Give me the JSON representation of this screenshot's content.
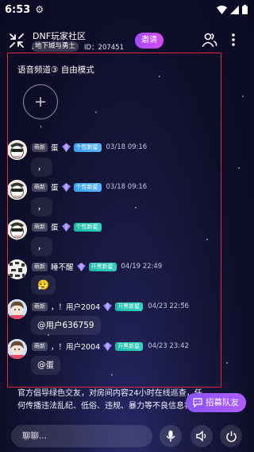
{
  "status_bar": {
    "time": "6:53"
  },
  "header": {
    "room_title": "DNF玩家社区",
    "room_tag": "地下城与勇士",
    "room_id": "ID：207451",
    "invite_label": "邀请"
  },
  "mic_area": {
    "channel_label": "语音频道③ 自由模式"
  },
  "messages": [
    {
      "badge": "萌新",
      "username": "蛋",
      "pill": "个性新星",
      "time": "03/18 09:16",
      "text": "，"
    },
    {
      "badge": "萌新",
      "username": "蛋",
      "pill": "个性新星",
      "time": "03/18 09:16",
      "text": "，"
    },
    {
      "badge": "萌新",
      "username": "蛋",
      "pill": "个性新星",
      "time": "",
      "text": "，"
    },
    {
      "badge": "萌新",
      "username": "睡不醒",
      "pill": "开黑新星",
      "time": "04/19 22:49",
      "text": "😮‍💨"
    },
    {
      "badge": "萌新",
      "username": "，！用户2004",
      "pill": "开黑新星",
      "time": "04/23 22:56",
      "text": "@用户636759"
    },
    {
      "badge": "萌新",
      "username": "，！用户2004",
      "pill": "开黑新星",
      "time": "04/23 23:42",
      "text": "@蛋"
    }
  ],
  "notice": {
    "text": "官方倡导绿色交友，对房间内容24小时在线巡查，任何传播违法乱纪、低俗、违规、暴力等不良信息将会"
  },
  "recruit_label": "招募队友",
  "chat": {
    "placeholder": "聊聊..."
  },
  "colors": {
    "invite": "#c04cf5",
    "recruit": "#9b58ff",
    "pill_blue": "#3aa0f2",
    "pill_teal": "#19b7a5",
    "highlight": "#e0283a"
  }
}
